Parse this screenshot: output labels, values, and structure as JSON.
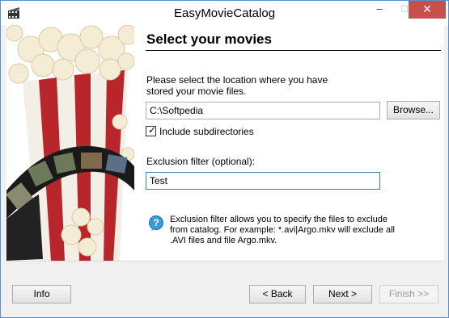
{
  "window": {
    "title": "EasyMovieCatalog",
    "controls": {
      "minimize": "–",
      "maximize": "□",
      "close": "✕"
    }
  },
  "page": {
    "header": "Select your movies",
    "description": "Please select the location where you have stored your movie files.",
    "path_value": "C:\\Softpedia",
    "browse_label": "Browse...",
    "include_subdirs": {
      "label": "Include subdirectories",
      "checked": true
    },
    "exclusion_label": "Exclusion filter (optional):",
    "exclusion_value": "Test",
    "help_text": "Exclusion filter allows you to specify the files to exclude from catalog. For example: *.avi|Argo.mkv will exclude all .AVI files and file Argo.mkv."
  },
  "buttons": {
    "info": "Info",
    "back": "< Back",
    "next": "Next >",
    "finish": "Finish >>"
  },
  "icons": {
    "app": "film-strip-icon",
    "help": "question-bubble-icon"
  },
  "colors": {
    "close_button": "#c7504a",
    "window_border": "#5a8fc7",
    "focused_input_border": "#3c7fb1"
  }
}
